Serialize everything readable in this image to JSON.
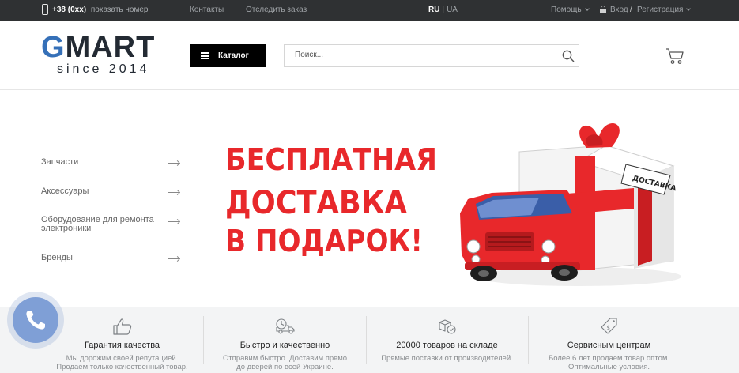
{
  "topbar": {
    "phone": "+38 (0xx)",
    "phone_link": "показать номер",
    "contacts": "Контакты",
    "track_order": "Отследить заказ",
    "lang_active": "RU",
    "lang_sep": "|",
    "lang_other": "UA",
    "help": "Помощь",
    "login": "Вход",
    "auth_sep": "/",
    "register": "Регистрация"
  },
  "header": {
    "logo_g": "G",
    "logo_rest": "MART",
    "logo_since": "since 2014",
    "catalog_label": "Каталог",
    "search_placeholder": "Поиск...",
    "search_value": ""
  },
  "sidebar": {
    "items": [
      {
        "label": "Запчасти"
      },
      {
        "label": "Аксессуары"
      },
      {
        "label": "Оборудование для ремонта электроники"
      },
      {
        "label": "Бренды"
      }
    ]
  },
  "banner": {
    "line1": "БЕСПЛАТНАЯ",
    "line2": "ДОСТАВКА",
    "line3": "В ПОДАРОК!",
    "tag": "ДОСТАВКА"
  },
  "features": [
    {
      "title": "Гарантия качества",
      "line1": "Мы дорожим своей репутацией.",
      "line2": "Продаем только качественный товар.",
      "icon": "thumbs-up-icon"
    },
    {
      "title": "Быстро и качественно",
      "line1": "Отправим быстро. Доставим прямо",
      "line2": "до дверей по всей Украине.",
      "icon": "delivery-truck-icon"
    },
    {
      "title": "20000 товаров на складе",
      "line1": "Прямые поставки от производителей.",
      "line2": "",
      "icon": "boxes-icon"
    },
    {
      "title": "Сервисным центрам",
      "line1": "Более 6 лет продаем товар оптом.",
      "line2": "Оптимальные условия.",
      "icon": "tag-icon"
    }
  ],
  "colors": {
    "topbar": "#2f3133",
    "brand_blue": "#3570b8",
    "banner_red": "#e8282b",
    "call_widget": "#7f9fd6"
  }
}
